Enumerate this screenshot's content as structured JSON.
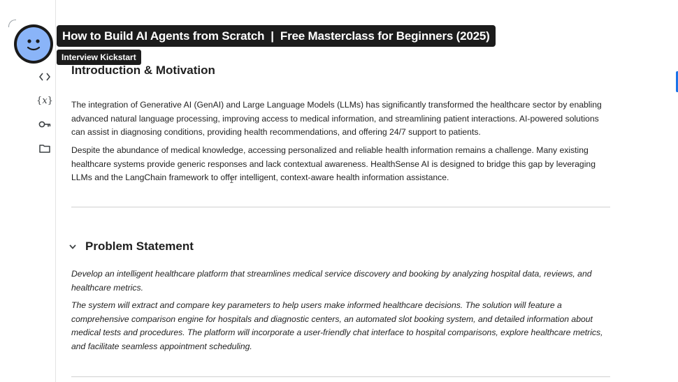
{
  "video": {
    "title": "How to Build AI Agents from Scratch  |  Free Masterclass for Beginners (2025)",
    "channel": "Interview Kickstart"
  },
  "sidebar": {
    "icons": [
      {
        "name": "code-icon",
        "glyph": "< >"
      },
      {
        "name": "variables-icon",
        "glyph": "{x}"
      },
      {
        "name": "key-icon",
        "glyph": "key"
      },
      {
        "name": "folder-icon",
        "glyph": "folder"
      }
    ]
  },
  "notebook": {
    "intro": {
      "heading": "Introduction & Motivation",
      "paragraphs": [
        "The integration of Generative AI (GenAI) and Large Language Models (LLMs) has significantly transformed the healthcare sector by enabling advanced natural language processing, improving access to medical information, and streamlining patient interactions. AI-powered solutions can assist in diagnosing conditions, providing health recommendations, and offering 24/7 support to patients.",
        "Despite the abundance of medical knowledge, accessing personalized and reliable health information remains a challenge. Many existing healthcare systems provide generic responses and lack contextual awareness. HealthSense AI is designed to bridge this gap by leveraging LLMs and the LangChain framework to offer intelligent, context-aware health information assistance."
      ]
    },
    "problem": {
      "heading": "Problem Statement",
      "paragraphs": [
        "Develop an intelligent healthcare platform that streamlines medical service discovery and booking by analyzing hospital data, reviews, and healthcare metrics.",
        "The system will extract and compare key parameters to help users make informed healthcare decisions. The solution will feature a comprehensive comparison engine for hospitals and diagnostic centers, an automated slot booking system, and detailed information about medical tests and procedures. The platform will incorporate a user-friendly chat interface to hospital comparisons, explore healthcare metrics, and facilitate seamless appointment scheduling."
      ]
    }
  },
  "colors": {
    "banner_bg": "#1c1c1c",
    "avatar_face": "#8ab4f8",
    "accent": "#1a73e8"
  }
}
